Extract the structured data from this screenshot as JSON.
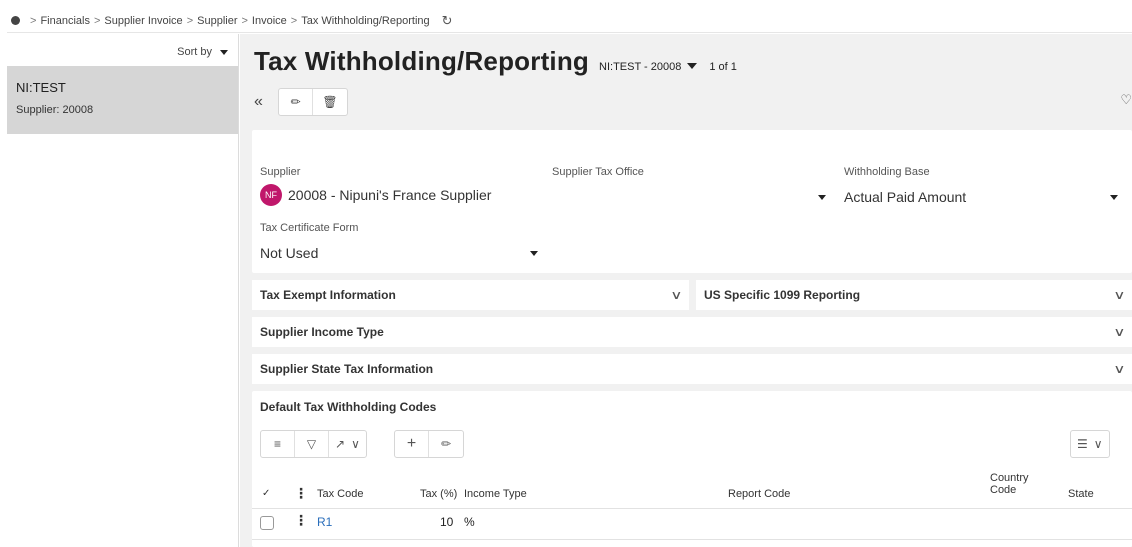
{
  "breadcrumb": {
    "items": [
      "Financials",
      "Supplier Invoice",
      "Supplier",
      "Invoice",
      "Tax Withholding/Reporting"
    ],
    "separator": ">"
  },
  "left_panel": {
    "sort_label": "Sort by",
    "record": {
      "name": "NI:TEST",
      "supplier_label": "Supplier:",
      "supplier_value": "20008"
    }
  },
  "header": {
    "title": "Tax Withholding/Reporting",
    "record_id": "NI:TEST - 20008",
    "record_count": "1 of 1"
  },
  "form": {
    "supplier": {
      "label": "Supplier",
      "avatar_initials": "NF",
      "value": "20008 - Nipuni's France Supplier"
    },
    "supplier_tax_office": {
      "label": "Supplier Tax Office",
      "value": ""
    },
    "withholding_base": {
      "label": "Withholding Base",
      "value": "Actual Paid Amount"
    },
    "tax_certificate_form": {
      "label": "Tax Certificate Form",
      "value": "Not Used"
    }
  },
  "sections": {
    "tax_exempt": "Tax Exempt Information",
    "us_1099": "US Specific 1099 Reporting",
    "income_type": "Supplier Income Type",
    "state_tax": "Supplier State Tax Information"
  },
  "table": {
    "title": "Default Tax Withholding Codes",
    "columns": {
      "tax_code": "Tax Code",
      "tax_pct": "Tax (%)",
      "income_type": "Income Type",
      "report_code": "Report Code",
      "country_code_line1": "Country",
      "country_code_line2": "Code",
      "state": "State"
    },
    "rows": [
      {
        "tax_code": "R1",
        "tax_pct": "10",
        "pct_sign": "%",
        "income_type": "",
        "report_code": "",
        "country_code": "",
        "state": ""
      }
    ]
  },
  "colors": {
    "avatar": "#c0176b",
    "link": "#2a6ebb",
    "main_bg": "#f1f1f1",
    "selected_record": "#d6d6d6"
  },
  "icons": [
    "status-dot-icon",
    "refresh-icon",
    "caret-down-icon",
    "collapse-left-icon",
    "edit-icon",
    "delete-icon",
    "heart-icon",
    "chevron-down-icon",
    "list-icon",
    "filter-icon",
    "export-icon",
    "add-icon",
    "kebab-icon",
    "checkbox-icon",
    "column-chooser-icon"
  ]
}
